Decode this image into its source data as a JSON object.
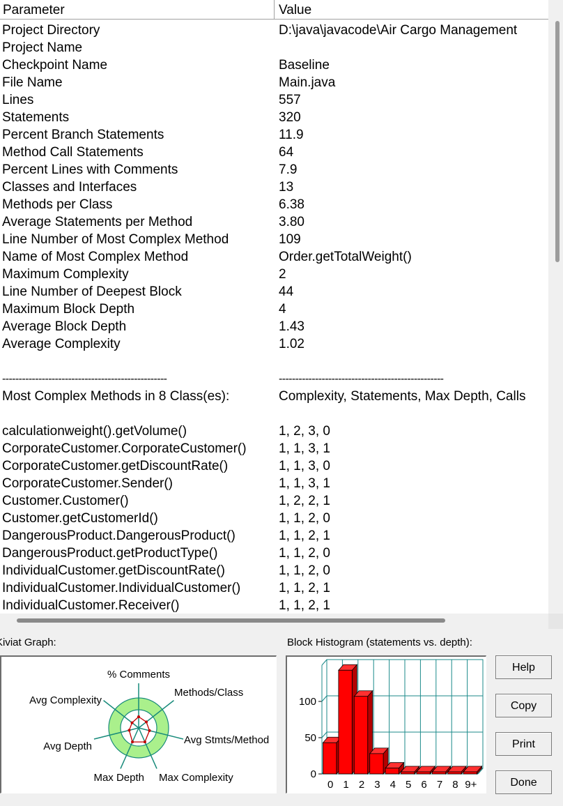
{
  "table": {
    "headers": [
      "Parameter",
      "Value"
    ],
    "rows": [
      [
        "Project Directory",
        "D:\\java\\javacode\\Air Cargo Management"
      ],
      [
        "Project Name",
        ""
      ],
      [
        "Checkpoint Name",
        "Baseline"
      ],
      [
        "File Name",
        "Main.java"
      ],
      [
        "Lines",
        "557"
      ],
      [
        "Statements",
        "320"
      ],
      [
        "Percent Branch Statements",
        "11.9"
      ],
      [
        "Method Call Statements",
        "64"
      ],
      [
        "Percent Lines with Comments",
        "7.9"
      ],
      [
        "Classes and Interfaces",
        "13"
      ],
      [
        "Methods per Class",
        "6.38"
      ],
      [
        "Average Statements per Method",
        "3.80"
      ],
      [
        "Line Number of Most Complex Method",
        "109"
      ],
      [
        "Name of Most Complex Method",
        "Order.getTotalWeight()"
      ],
      [
        "Maximum Complexity",
        "2"
      ],
      [
        "Line Number of Deepest Block",
        "44"
      ],
      [
        "Maximum Block Depth",
        "4"
      ],
      [
        "Average Block Depth",
        "1.43"
      ],
      [
        "Average Complexity",
        "1.02"
      ],
      [
        "",
        ""
      ],
      [
        "--------------------------------------------------",
        "--------------------------------------------------"
      ],
      [
        "Most Complex Methods in 8 Class(es):",
        "Complexity, Statements, Max Depth, Calls"
      ],
      [
        "",
        ""
      ],
      [
        "calculationweight().getVolume()",
        "1, 2, 3, 0"
      ],
      [
        "CorporateCustomer.CorporateCustomer()",
        "1, 1, 3, 1"
      ],
      [
        "CorporateCustomer.getDiscountRate()",
        "1, 1, 3, 0"
      ],
      [
        "CorporateCustomer.Sender()",
        "1, 1, 3, 1"
      ],
      [
        "Customer.Customer()",
        "1, 2, 2, 1"
      ],
      [
        "Customer.getCustomerId()",
        "1, 1, 2, 0"
      ],
      [
        "DangerousProduct.DangerousProduct()",
        "1, 1, 2, 1"
      ],
      [
        "DangerousProduct.getProductType()",
        "1, 1, 2, 0"
      ],
      [
        "IndividualCustomer.getDiscountRate()",
        "1, 1, 2, 0"
      ],
      [
        "IndividualCustomer.IndividualCustomer()",
        "1, 1, 2, 1"
      ],
      [
        "IndividualCustomer.Receiver()",
        "1, 1, 2, 1"
      ]
    ]
  },
  "kiviat": {
    "caption": "Kiviat Graph:",
    "axes": [
      "% Comments",
      "Methods/Class",
      "Avg Stmts/Method",
      "Max Complexity",
      "Max Depth",
      "Avg Depth",
      "Avg Complexity"
    ]
  },
  "chart_data": {
    "type": "bar",
    "title": "Block Histogram (statements vs. depth):",
    "categories": [
      "0",
      "1",
      "2",
      "3",
      "4",
      "5",
      "6",
      "7",
      "8",
      "9+"
    ],
    "values": [
      43,
      143,
      107,
      28,
      8,
      1,
      0,
      0,
      0,
      0
    ],
    "ylim": [
      0,
      150
    ],
    "yticks": [
      "0",
      "50",
      "100"
    ],
    "grid": true,
    "bar_color": "#ff0000"
  },
  "buttons": {
    "help": "Help",
    "copy": "Copy",
    "print": "Print",
    "done": "Done"
  }
}
